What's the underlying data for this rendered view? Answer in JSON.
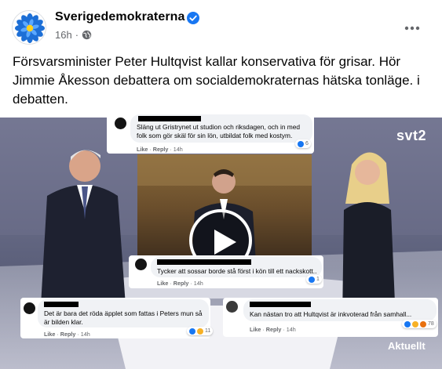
{
  "post": {
    "page_name": "Sverigedemokraterna",
    "time": "16h",
    "text": "Försvarsminister Peter Hultqvist kallar konservativa för grisar. Hör Jimmie Åkesson debattera om socialdemokraternas hätska tonläge. i debatten.",
    "icons": {
      "verified": "verified-badge-icon",
      "audience": "globe-icon",
      "menu": "more-options-icon",
      "avatar": "blue-flower-logo"
    }
  },
  "video": {
    "channel_logo": "svt2",
    "program_label": "Aktuellt",
    "play_icon": "play-icon"
  },
  "comments": [
    {
      "text": "Släng ut Gristrynet ut studion och riksdagen, och in med folk som gör skäl för sin lön, utbildat folk med kostym.",
      "like": "Like",
      "sep": "·",
      "reply": "Reply",
      "time": "14h",
      "reactions": "6"
    },
    {
      "text": "Tycker att sossar borde stå först i kön till ett nackskott..",
      "like": "Like",
      "sep": "·",
      "reply": "Reply",
      "time": "14h",
      "reactions": "1"
    },
    {
      "text": "Det är bara det röda äpplet som fattas i Peters mun så är bilden klar.",
      "like": "Like",
      "sep": "·",
      "reply": "Reply",
      "time": "14h",
      "reactions": "11"
    },
    {
      "text": "Kan nästan tro att Hultqvist är inkvoterad från samhall...",
      "like": "Like",
      "sep": "·",
      "reply": "Reply",
      "time": "14h",
      "reactions": "78"
    }
  ],
  "colors": {
    "link_blue": "#1877f2",
    "meta_grey": "#65676b",
    "bubble": "#f0f2f5"
  }
}
